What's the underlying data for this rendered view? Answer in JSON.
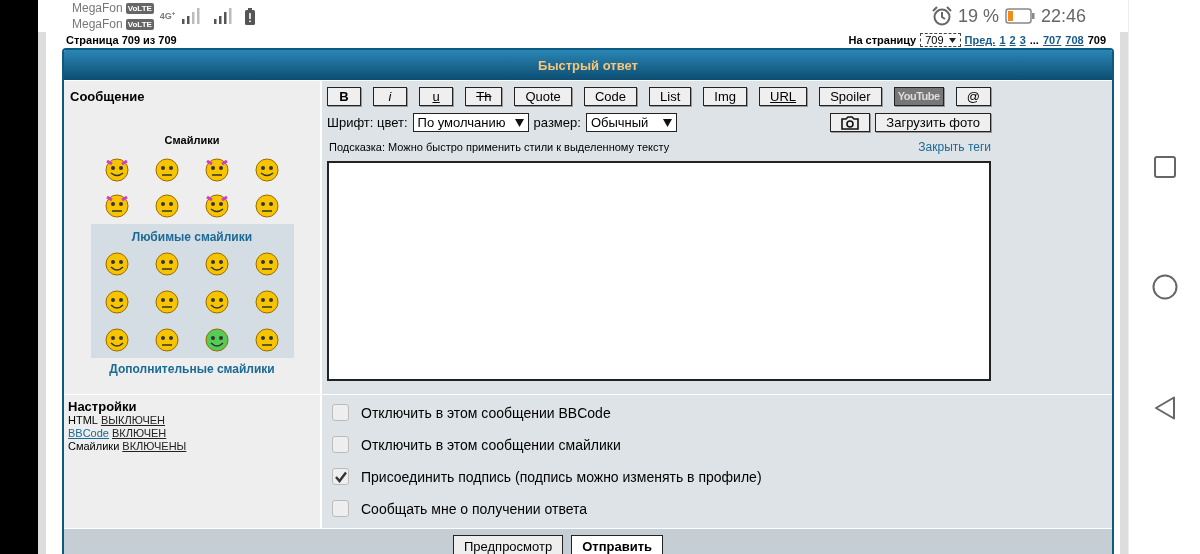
{
  "status_bar": {
    "carriers": [
      {
        "name": "MegaFon",
        "badge": "VoLTE"
      },
      {
        "name": "MegaFon",
        "badge": "VoLTE"
      }
    ],
    "network": "4G⁺",
    "battery_percent": "19 %",
    "time": "22:46"
  },
  "page": {
    "page_info": "Страница 709 из 709",
    "pagination": {
      "label": "На страницу",
      "select": "709",
      "prev": "Пред.",
      "pages": [
        "1",
        "2",
        "3"
      ],
      "ellipsis": "...",
      "last_pages": [
        "707",
        "708"
      ],
      "current": "709"
    }
  },
  "form": {
    "title": "Быстрый ответ",
    "message_label": "Сообщение",
    "smilies_title": "Смайлики",
    "favourites_link": "Любимые смайлики",
    "more_smilies_link": "Дополнительные смайлики",
    "toolbar": [
      {
        "label": "B",
        "kind": "bold"
      },
      {
        "label": "i",
        "kind": "italic"
      },
      {
        "label": "u",
        "kind": "underline"
      },
      {
        "label": "Th",
        "kind": "strike"
      },
      {
        "label": "Quote",
        "kind": "plain"
      },
      {
        "label": "Code",
        "kind": "plain"
      },
      {
        "label": "List",
        "kind": "plain"
      },
      {
        "label": "Img",
        "kind": "plain"
      },
      {
        "label": "URL",
        "kind": "underline"
      },
      {
        "label": "Spoiler",
        "kind": "plain"
      },
      {
        "label": "YouTube",
        "kind": "logo"
      },
      {
        "label": "@",
        "kind": "plain"
      }
    ],
    "font_label": "Шрифт: цвет:",
    "color_select": "По умолчанию",
    "size_label": "размер:",
    "size_select": "Обычный",
    "upload_button": "Загрузить фото",
    "hint": "Подсказка: Можно быстро применить стили к выделенному тексту",
    "close_tags_link": "Закрыть теги",
    "settings": {
      "title": "Настройки",
      "lines": [
        {
          "name": "HTML",
          "link": false,
          "value": "ВЫКЛЮЧЕН"
        },
        {
          "name": "BBCode",
          "link": true,
          "value": "ВКЛЮЧЕН"
        },
        {
          "name": "Смайлики",
          "link": false,
          "value": "ВКЛЮЧЕНЫ"
        }
      ]
    },
    "options": [
      {
        "label": "Отключить в этом сообщении BBCode",
        "checked": false
      },
      {
        "label": "Отключить в этом сообщении смайлики",
        "checked": false
      },
      {
        "label": "Присоединить подпись (подпись можно изменять в профиле)",
        "checked": true
      },
      {
        "label": "Сообщать мне о получении ответа",
        "checked": false
      }
    ],
    "buttons": [
      {
        "label": "Предпросмотр",
        "kind": "default"
      },
      {
        "label": "Отправить",
        "kind": "primary"
      }
    ]
  }
}
